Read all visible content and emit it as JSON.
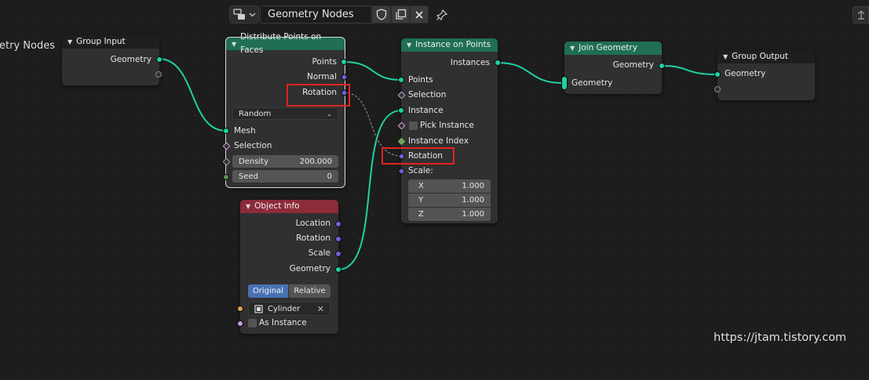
{
  "header": {
    "tree_name": "Geometry Nodes",
    "tree_title_partial": "etry Nodes"
  },
  "nodes": {
    "group_input": {
      "title": "Group Input",
      "outputs": [
        "Geometry"
      ]
    },
    "distribute": {
      "title": "Distribute Points on Faces",
      "outputs": [
        "Points",
        "Normal",
        "Rotation"
      ],
      "mode": "Random",
      "inputs": [
        "Mesh",
        "Selection"
      ],
      "density_label": "Density",
      "density_value": "200.000",
      "seed_label": "Seed",
      "seed_value": "0"
    },
    "object_info": {
      "title": "Object Info",
      "outputs": [
        "Location",
        "Rotation",
        "Scale",
        "Geometry"
      ],
      "mode_original": "Original",
      "mode_relative": "Relative",
      "object": "Cylinder",
      "as_instance": "As Instance"
    },
    "instance_on_points": {
      "title": "Instance on Points",
      "output": "Instances",
      "inputs": [
        "Points",
        "Selection",
        "Instance",
        "Pick Instance",
        "Instance Index",
        "Rotation",
        "Scale:"
      ],
      "scale": [
        {
          "axis": "X",
          "value": "1.000"
        },
        {
          "axis": "Y",
          "value": "1.000"
        },
        {
          "axis": "Z",
          "value": "1.000"
        }
      ]
    },
    "join_geometry": {
      "title": "Join Geometry",
      "output": "Geometry",
      "input": "Geometry"
    },
    "group_output": {
      "title": "Group Output",
      "input": "Geometry"
    }
  },
  "watermark": "https://jtam.tistory.com",
  "colors": {
    "geometry_socket": "#1fd1a1",
    "vector_socket": "#6c63d9",
    "highlight": "#e02323",
    "green_header": "#1f6e55",
    "red_header": "#8d2b3a"
  }
}
